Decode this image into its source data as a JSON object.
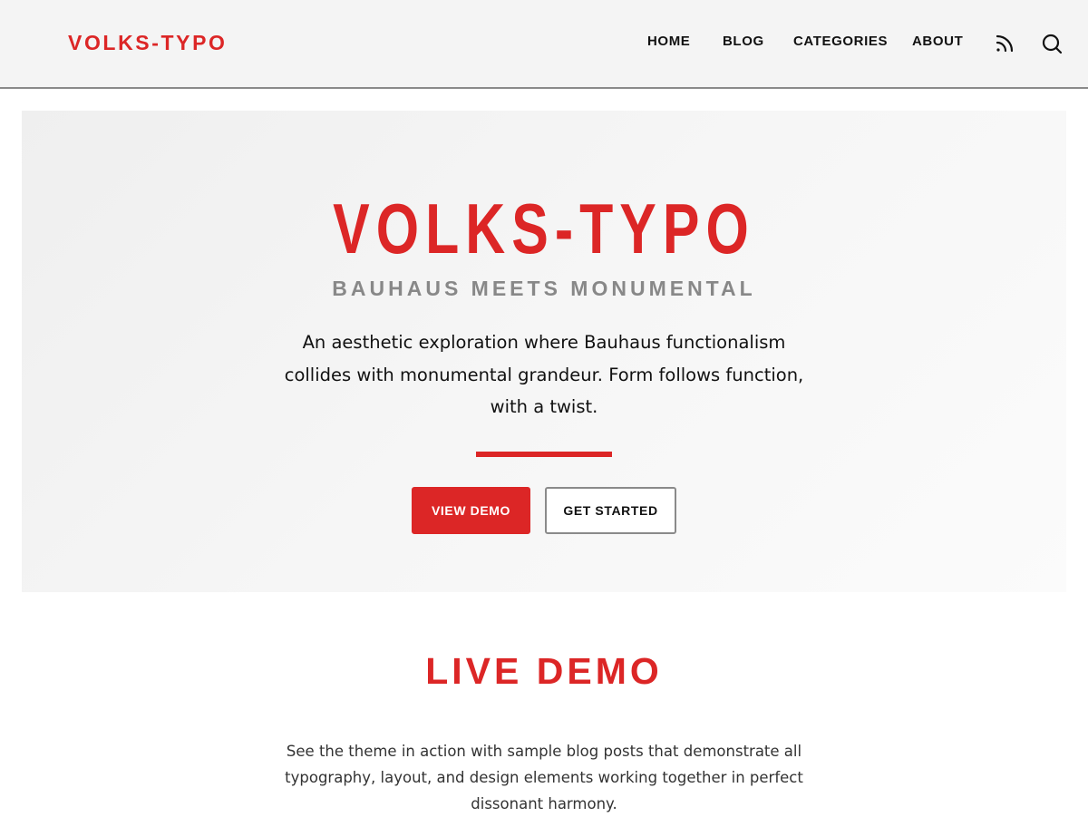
{
  "header": {
    "brand": "VOLKS-TYPO",
    "nav": [
      {
        "label": "HOME"
      },
      {
        "label": "BLOG"
      },
      {
        "label": "CATEGORIES"
      },
      {
        "label": "ABOUT"
      }
    ],
    "icons": [
      "rss-icon",
      "search-icon"
    ]
  },
  "hero": {
    "title": "VOLKS-TYPO",
    "subtitle": "BAUHAUS MEETS MONUMENTAL",
    "description": "An aesthetic exploration where Bauhaus functionalism collides with monumental grandeur. Form follows function, with a twist.",
    "primary_button": "VIEW DEMO",
    "secondary_button": "GET STARTED"
  },
  "live_demo": {
    "title": "LIVE DEMO",
    "description": "See the theme in action with sample blog posts that demonstrate all typography, layout, and design elements working together in perfect dissonant harmony."
  },
  "colors": {
    "accent": "#dc2626",
    "header_bg": "#f4f4f4",
    "muted_text": "#888888",
    "text": "#111111"
  }
}
